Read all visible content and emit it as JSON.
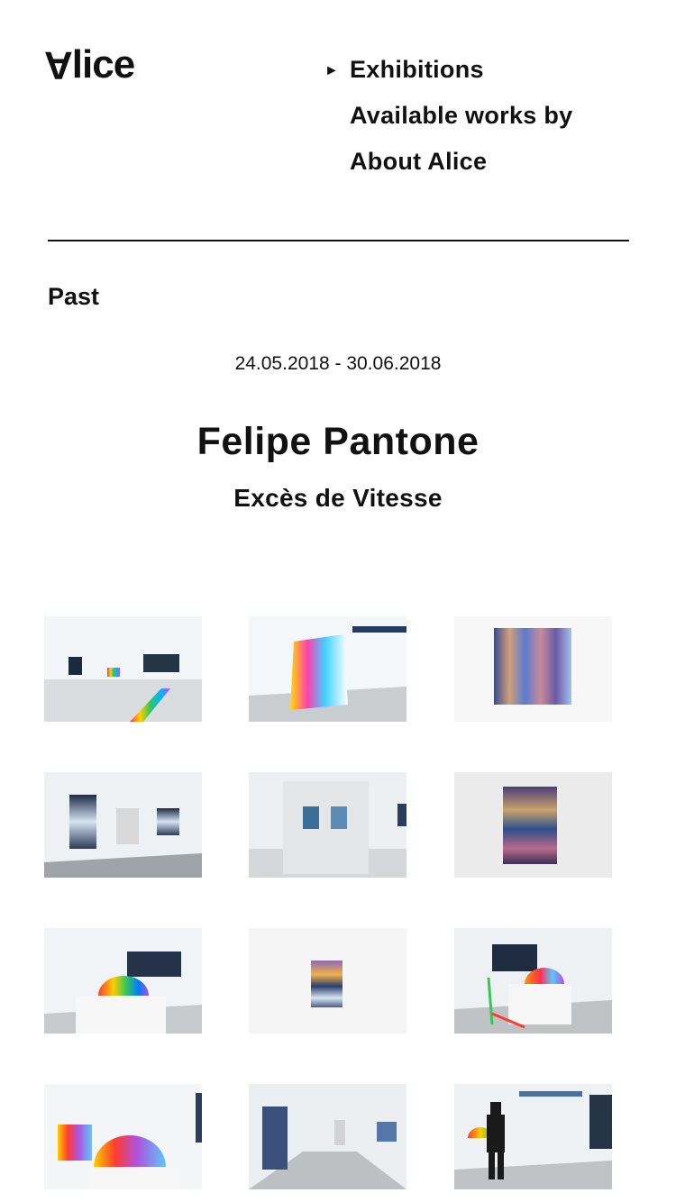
{
  "header": {
    "logo_text": "Alice",
    "nav": [
      {
        "label": "Exhibitions",
        "active": true
      },
      {
        "label": "Available works by",
        "active": false
      },
      {
        "label": "About Alice",
        "active": false
      }
    ],
    "active_marker": "►"
  },
  "section": "Past",
  "exhibition": {
    "dates": "24.05.2018 - 30.06.2018",
    "artist": "Felipe Pantone",
    "title": "Excès de Vitesse"
  },
  "gallery": {
    "items": [
      {
        "kind": "gallery-room-1"
      },
      {
        "kind": "rainbow-panel"
      },
      {
        "kind": "wall-painting-1"
      },
      {
        "kind": "gallery-room-2"
      },
      {
        "kind": "partition-wall"
      },
      {
        "kind": "wall-painting-2"
      },
      {
        "kind": "dome-sculpture-1"
      },
      {
        "kind": "framed-work"
      },
      {
        "kind": "dome-sculpture-2"
      },
      {
        "kind": "dome-sculpture-3"
      },
      {
        "kind": "corridor-view"
      },
      {
        "kind": "artist-in-gallery"
      }
    ]
  },
  "colors": {
    "text": "#111111",
    "background": "#ffffff",
    "divider": "#111111"
  }
}
